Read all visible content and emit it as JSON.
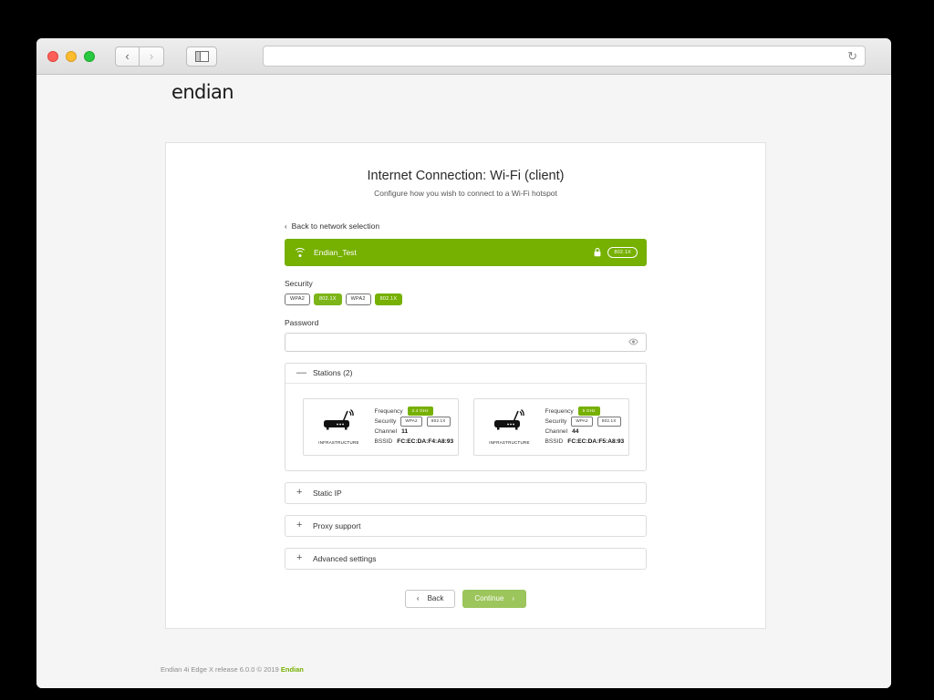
{
  "browser": {
    "back_label": "‹",
    "forward_label": "›",
    "url_value": "",
    "url_placeholder": "",
    "reload_label": "↻"
  },
  "brand": {
    "logo": "endian"
  },
  "header": {
    "title": "Internet Connection: Wi-Fi (client)",
    "subtitle": "Configure how you wish to connect to a Wi-Fi hotspot"
  },
  "back_link": {
    "label": "Back to network selection",
    "chevron": "‹"
  },
  "network": {
    "ssid": "Endian_Test",
    "security_badge": "802.1X"
  },
  "security": {
    "label": "Security",
    "badges": [
      {
        "text": "WPA2",
        "style": "outline"
      },
      {
        "text": "802.1X",
        "style": "solid"
      },
      {
        "text": "WPA2",
        "style": "outline"
      },
      {
        "text": "802.1X",
        "style": "solid-bright"
      }
    ]
  },
  "password": {
    "label": "Password",
    "value": "",
    "placeholder": "",
    "toggle_icon": "eye-icon"
  },
  "stations_panel": {
    "title": "Stations (2)",
    "sign": "—",
    "expanded": true,
    "labels": {
      "frequency": "Frequency",
      "security": "Security",
      "channel": "Channel",
      "bssid": "BSSID",
      "mode": "INFRASTRUCTURE"
    },
    "items": [
      {
        "mode": "INFRASTRUCTURE",
        "frequency": "2.4 GHz",
        "security": [
          "WPA2",
          "802.1X"
        ],
        "channel": "11",
        "bssid": "FC:EC:DA:F4:A8:93"
      },
      {
        "mode": "INFRASTRUCTURE",
        "frequency": "5 GHz",
        "security": [
          "WPA2",
          "802.1X"
        ],
        "channel": "44",
        "bssid": "FC:EC:DA:F5:A8:93"
      }
    ]
  },
  "sections": [
    {
      "title": "Static IP",
      "sign": "+"
    },
    {
      "title": "Proxy support",
      "sign": "+"
    },
    {
      "title": "Advanced settings",
      "sign": "+"
    }
  ],
  "buttons": {
    "back": {
      "label": "Back",
      "chevron": "‹"
    },
    "continue": {
      "label": "Continue",
      "chevron": "›"
    }
  },
  "footer": {
    "text": "Endian 4i Edge X release 6.0.0 © 2019 ",
    "brand": "Endian"
  },
  "colors": {
    "brand_green": "#76b000",
    "badge_green": "#7cb518",
    "continue_green": "#9cc55c"
  }
}
